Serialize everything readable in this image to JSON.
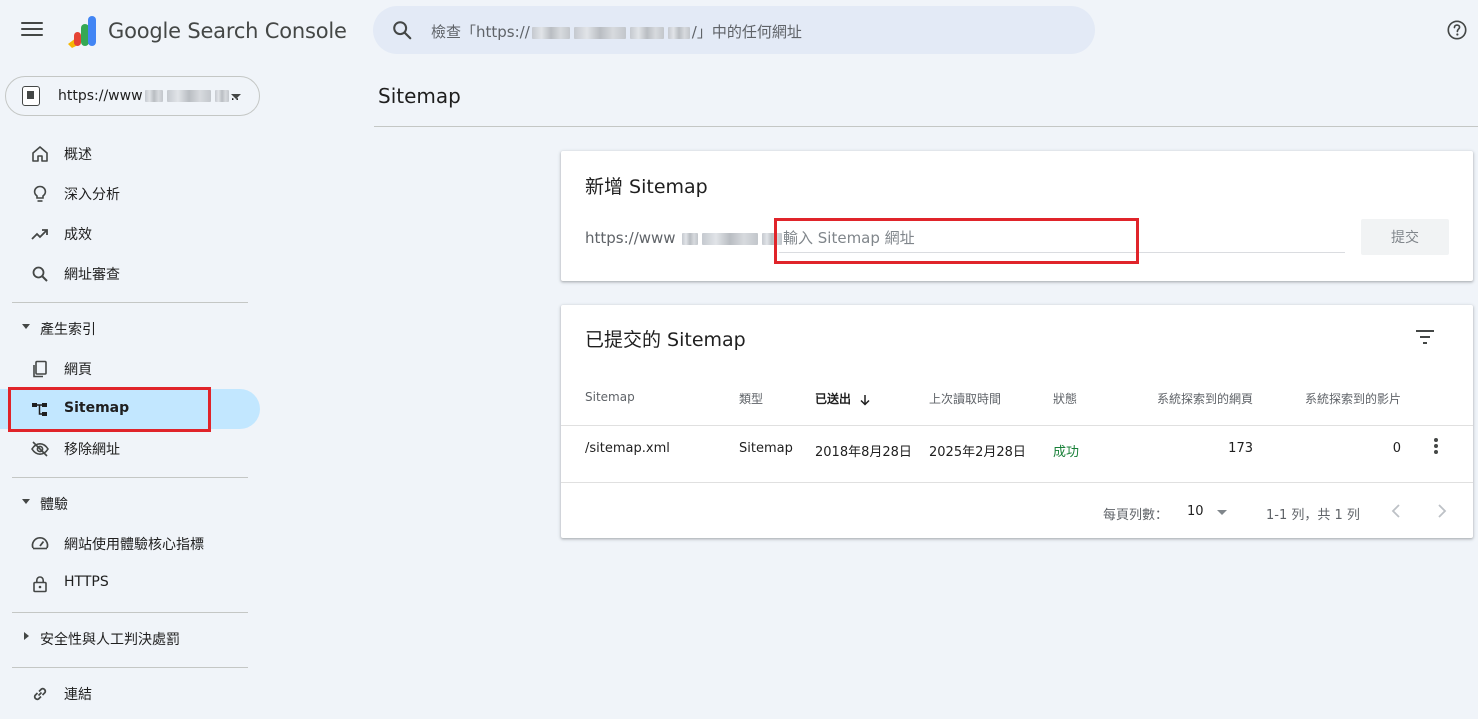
{
  "header": {
    "brand": "Google Search Console",
    "search_prefix": "檢查「https://",
    "search_suffix": "/」中的任何網址"
  },
  "property": {
    "label": "https://www"
  },
  "sidebar": {
    "items": [
      {
        "label": "概述",
        "icon": "home-icon"
      },
      {
        "label": "深入分析",
        "icon": "lightbulb-icon"
      },
      {
        "label": "成效",
        "icon": "trending-up-icon"
      },
      {
        "label": "網址審查",
        "icon": "search-icon"
      }
    ],
    "indexing": {
      "section": "產生索引",
      "items": [
        {
          "label": "網頁",
          "icon": "pages-icon"
        },
        {
          "label": "Sitemap",
          "icon": "sitemap-icon",
          "active": true
        },
        {
          "label": "移除網址",
          "icon": "eye-off-icon"
        }
      ]
    },
    "experience": {
      "section": "體驗",
      "items": [
        {
          "label": "網站使用體驗核心指標",
          "icon": "speedometer-icon"
        },
        {
          "label": "HTTPS",
          "icon": "lock-icon"
        }
      ]
    },
    "security": {
      "section": "安全性與人工判決處罰"
    },
    "links": {
      "label": "連結",
      "icon": "link-icon"
    }
  },
  "main": {
    "title": "Sitemap",
    "add": {
      "title": "新增 Sitemap",
      "url_prefix": "https://www",
      "placeholder": "輸入 Sitemap 網址",
      "submit": "提交"
    },
    "submitted": {
      "title": "已提交的 Sitemap",
      "columns": {
        "sitemap": "Sitemap",
        "type": "類型",
        "submitted": "已送出",
        "last_read": "上次讀取時間",
        "status": "狀態",
        "pages": "系統探索到的網頁",
        "videos": "系統探索到的影片"
      },
      "rows": [
        {
          "sitemap": "/sitemap.xml",
          "type": "Sitemap",
          "submitted": "2018年8月28日",
          "last_read": "2025年2月28日",
          "status": "成功",
          "pages": "173",
          "videos": "0"
        }
      ],
      "pagination": {
        "rows_label": "每頁列數：",
        "rows_value": "10",
        "range": "1-1 列，共 1 列"
      }
    }
  }
}
